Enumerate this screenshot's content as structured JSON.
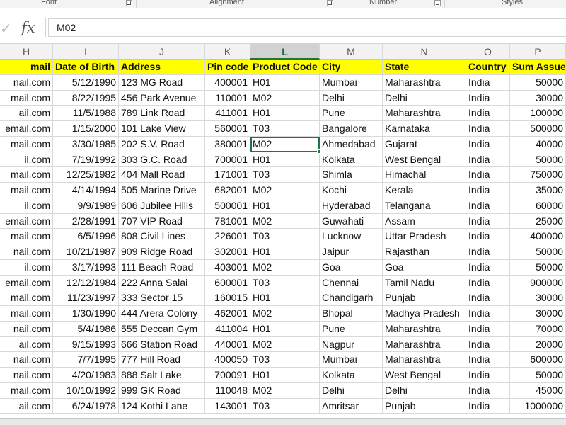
{
  "ribbon": {
    "groups": [
      "Font",
      "Alignment",
      "Number",
      "Styles"
    ]
  },
  "formula_bar": {
    "enter_icon": "checkmark-icon",
    "fx_label": "fx",
    "value": "M02"
  },
  "grid": {
    "active_column": "L",
    "selected_cell": "L row 6 (Ahmedabad)",
    "columns": [
      "H",
      "I",
      "J",
      "K",
      "L",
      "M",
      "N",
      "O",
      "P"
    ],
    "header_row": [
      "mail",
      "Date of Birth",
      "Address",
      "Pin code",
      "Product Code",
      "City",
      "State",
      "Country",
      "Sum Assuer"
    ],
    "rows": [
      [
        "nail.com",
        "5/12/1990",
        "123 MG Road",
        "400001",
        "H01",
        "Mumbai",
        "Maharashtra",
        "India",
        "50000"
      ],
      [
        "mail.com",
        "8/22/1995",
        "456 Park Avenue",
        "110001",
        "M02",
        "Delhi",
        "Delhi",
        "India",
        "30000"
      ],
      [
        "ail.com",
        "11/5/1988",
        "789 Link Road",
        "411001",
        "H01",
        "Pune",
        "Maharashtra",
        "India",
        "100000"
      ],
      [
        "email.com",
        "1/15/2000",
        "101 Lake View",
        "560001",
        "T03",
        "Bangalore",
        "Karnataka",
        "India",
        "500000"
      ],
      [
        "mail.com",
        "3/30/1985",
        "202 S.V. Road",
        "380001",
        "M02",
        "Ahmedabad",
        "Gujarat",
        "India",
        "40000"
      ],
      [
        "il.com",
        "7/19/1992",
        "303 G.C. Road",
        "700001",
        "H01",
        "Kolkata",
        "West Bengal",
        "India",
        "50000"
      ],
      [
        "mail.com",
        "12/25/1982",
        "404 Mall Road",
        "171001",
        "T03",
        "Shimla",
        "Himachal",
        "India",
        "750000"
      ],
      [
        "mail.com",
        "4/14/1994",
        "505 Marine Drive",
        "682001",
        "M02",
        "Kochi",
        "Kerala",
        "India",
        "35000"
      ],
      [
        "il.com",
        "9/9/1989",
        "606 Jubilee Hills",
        "500001",
        "H01",
        "Hyderabad",
        "Telangana",
        "India",
        "60000"
      ],
      [
        "email.com",
        "2/28/1991",
        "707 VIP Road",
        "781001",
        "M02",
        "Guwahati",
        "Assam",
        "India",
        "25000"
      ],
      [
        "mail.com",
        "6/5/1996",
        "808 Civil Lines",
        "226001",
        "T03",
        "Lucknow",
        "Uttar Pradesh",
        "India",
        "400000"
      ],
      [
        "nail.com",
        "10/21/1987",
        "909 Ridge Road",
        "302001",
        "H01",
        "Jaipur",
        "Rajasthan",
        "India",
        "50000"
      ],
      [
        "il.com",
        "3/17/1993",
        "111 Beach Road",
        "403001",
        "M02",
        "Goa",
        "Goa",
        "India",
        "50000"
      ],
      [
        "email.com",
        "12/12/1984",
        "222 Anna Salai",
        "600001",
        "T03",
        "Chennai",
        "Tamil Nadu",
        "India",
        "900000"
      ],
      [
        "mail.com",
        "11/23/1997",
        "333 Sector 15",
        "160015",
        "H01",
        "Chandigarh",
        "Punjab",
        "India",
        "30000"
      ],
      [
        "mail.com",
        "1/30/1990",
        "444 Arera Colony",
        "462001",
        "M02",
        "Bhopal",
        "Madhya Pradesh",
        "India",
        "30000"
      ],
      [
        "nail.com",
        "5/4/1986",
        "555 Deccan Gym",
        "411004",
        "H01",
        "Pune",
        "Maharashtra",
        "India",
        "70000"
      ],
      [
        "ail.com",
        "9/15/1993",
        "666 Station Road",
        "440001",
        "M02",
        "Nagpur",
        "Maharashtra",
        "India",
        "20000"
      ],
      [
        "nail.com",
        "7/7/1995",
        "777 Hill Road",
        "400050",
        "T03",
        "Mumbai",
        "Maharashtra",
        "India",
        "600000"
      ],
      [
        "nail.com",
        "4/20/1983",
        "888 Salt Lake",
        "700091",
        "H01",
        "Kolkata",
        "West Bengal",
        "India",
        "50000"
      ],
      [
        "mail.com",
        "10/10/1992",
        "999 GK Road",
        "110048",
        "M02",
        "Delhi",
        "Delhi",
        "India",
        "45000"
      ],
      [
        "ail.com",
        "6/24/1978",
        "124 Kothi Lane",
        "143001",
        "T03",
        "Amritsar",
        "Punjab",
        "India",
        "1000000"
      ]
    ]
  },
  "colors": {
    "header_fill": "#ffff00",
    "selection": "#217346",
    "gridline": "#d9d9d9"
  }
}
